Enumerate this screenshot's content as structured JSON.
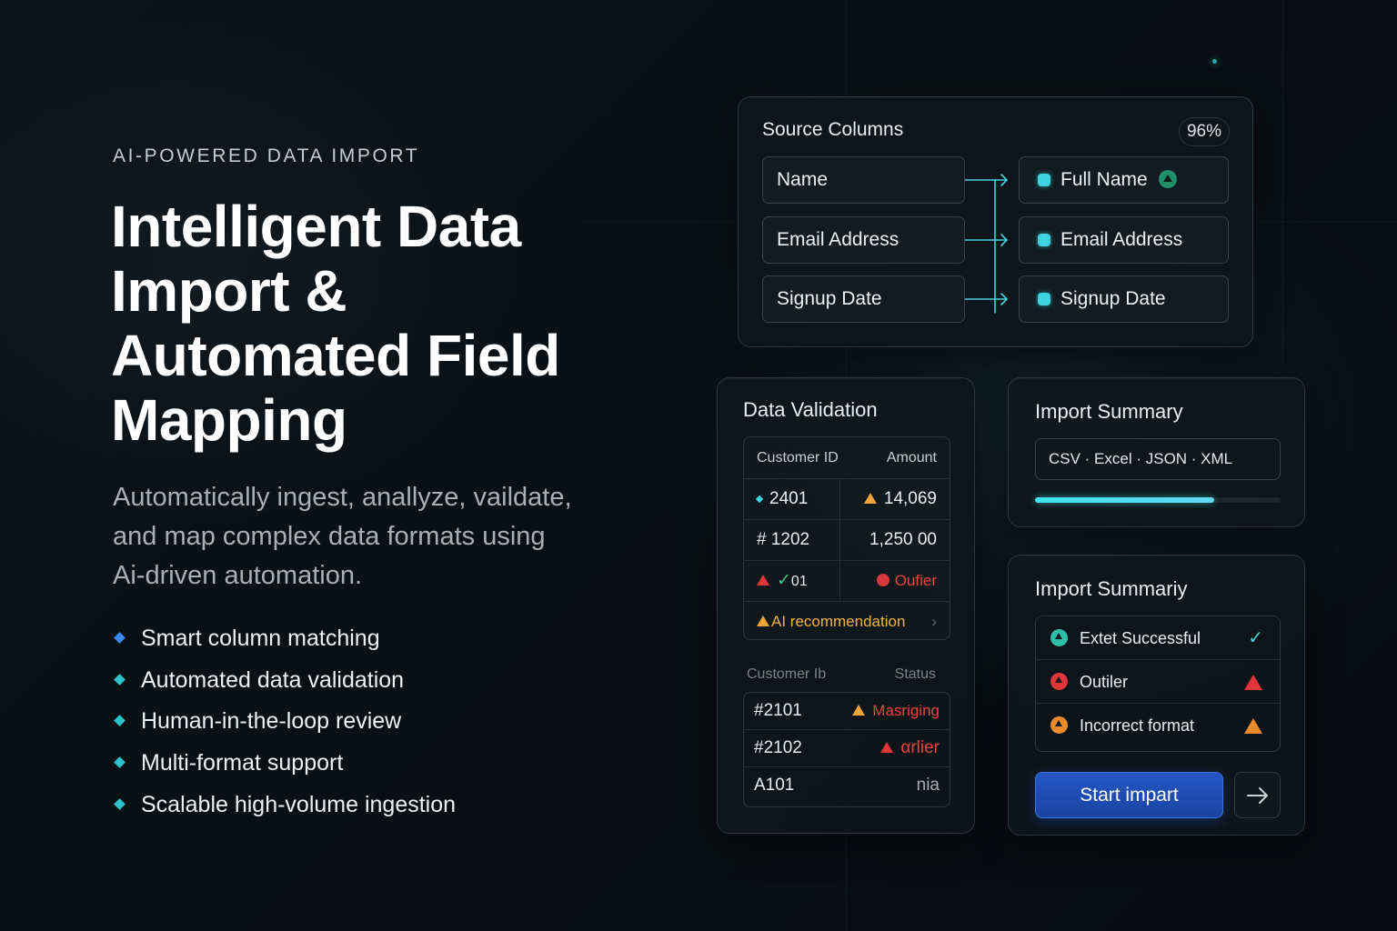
{
  "hero": {
    "eyebrow": "AI-POWERED DATA IMPORT",
    "headline_lines": [
      "Intelligent Data",
      "Import &",
      "Automated Field",
      "Mapping"
    ],
    "subtitle_lines": [
      "Automatically ingest, anallyze, vaildate,",
      "and map complex data formats using",
      "Ai-driven automation."
    ],
    "features": [
      "Smart column matching",
      "Automated data validation",
      "Human-in-the-loop review",
      "Multi-format support",
      "Scalable high-volume ingestion"
    ]
  },
  "mapping": {
    "title": "Source Columns",
    "confidence": "96%",
    "source_fields": [
      "Name",
      "Email Address",
      "Signup Date"
    ],
    "target_fields": [
      "Full Name",
      "Email Address",
      "Signup Date"
    ]
  },
  "validation": {
    "title": "Data Validation",
    "headers": [
      "Customer ID",
      "Amount"
    ],
    "rows": [
      {
        "id": "2401",
        "amount": "14,069"
      },
      {
        "id": "# 1202",
        "amount": "1,250 00"
      },
      {
        "id": "01",
        "amount": "Oufier"
      }
    ],
    "recommendation": "AI recommendation",
    "status_headers": [
      "Customer Ib",
      "Status"
    ],
    "status_rows": [
      {
        "id": "#2101",
        "status": "Masriging"
      },
      {
        "id": "#2102",
        "status": "αrlier"
      },
      {
        "id": "A101",
        "status": "nia"
      }
    ]
  },
  "summary": {
    "title": "Import Summary",
    "formats": "CSV ·  Excel · JSON · XML",
    "progress": 0.73
  },
  "summary2": {
    "title": "Import Summariy",
    "items": [
      {
        "label": "Extet Successful",
        "color": "#2fbfa6",
        "icon": "check-icon"
      },
      {
        "label": "Outiler",
        "color": "#e0363a",
        "icon": "warning-icon"
      },
      {
        "label": "Incorrect format",
        "color": "#e98a2e",
        "icon": "warning-icon"
      }
    ],
    "start_button": "Start impart"
  },
  "colors": {
    "accent_cyan": "#3fd3e0",
    "button_blue": "#2456c4",
    "warning_amber": "#f3a93d",
    "error_red": "#e0363a"
  }
}
